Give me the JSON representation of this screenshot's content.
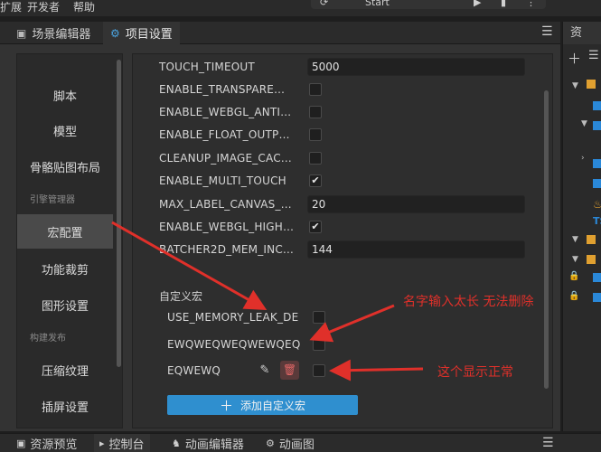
{
  "menubar": {
    "items": [
      "扩展",
      "开发者",
      "帮助"
    ],
    "toolbar_text": "Start"
  },
  "main_tabs": [
    {
      "label": "场景编辑器",
      "active": false
    },
    {
      "label": "项目设置",
      "active": true
    }
  ],
  "right_panel": {
    "tab_label": "资"
  },
  "sidebar": {
    "items": [
      {
        "label": "脚本"
      },
      {
        "label": "模型"
      },
      {
        "label": "骨骼贴图布局"
      },
      {
        "group": "引擎管理器"
      },
      {
        "label": "宏配置",
        "active": true
      },
      {
        "label": "功能裁剪"
      },
      {
        "label": "图形设置"
      },
      {
        "group": "构建发布"
      },
      {
        "label": "压缩纹理"
      },
      {
        "label": "插屏设置"
      }
    ]
  },
  "macros": [
    {
      "name": "TOUCH_TIMEOUT",
      "value": "5000"
    },
    {
      "name": "ENABLE_TRANSPARE…",
      "checked": false
    },
    {
      "name": "ENABLE_WEBGL_ANTI…",
      "checked": false
    },
    {
      "name": "ENABLE_FLOAT_OUTP…",
      "checked": false
    },
    {
      "name": "CLEANUP_IMAGE_CAC…",
      "checked": false
    },
    {
      "name": "ENABLE_MULTI_TOUCH",
      "checked": true
    },
    {
      "name": "MAX_LABEL_CANVAS_…",
      "value": "20"
    },
    {
      "name": "ENABLE_WEBGL_HIGH…",
      "checked": true
    },
    {
      "name": "BATCHER2D_MEM_INC…",
      "value": "144"
    }
  ],
  "custom_section": {
    "title": "自定义宏",
    "items": [
      {
        "name": "USE_MEMORY_LEAK_DE",
        "checked": false
      },
      {
        "name": "EWQWEQWEQWEWQEQ",
        "checked": false
      },
      {
        "name": "EQWEWQ",
        "checked": false
      }
    ],
    "add_button_label": "添加自定义宏"
  },
  "annotations": {
    "name_too_long": "名字输入太长 无法删除",
    "display_normal": "这个显示正常",
    "color": "#e0302a"
  },
  "bottom_tabs": [
    {
      "label": "资源预览",
      "active": false
    },
    {
      "label": "控制台",
      "active": true
    },
    {
      "label": "动画编辑器",
      "active": false
    },
    {
      "label": "动画图",
      "active": false
    }
  ],
  "icons": {
    "checkmark": "✔",
    "edit": "edit-icon",
    "delete": "trash-icon",
    "add": "plus-icon",
    "menu": "hamburger-menu-icon",
    "gear": "gear-icon"
  }
}
